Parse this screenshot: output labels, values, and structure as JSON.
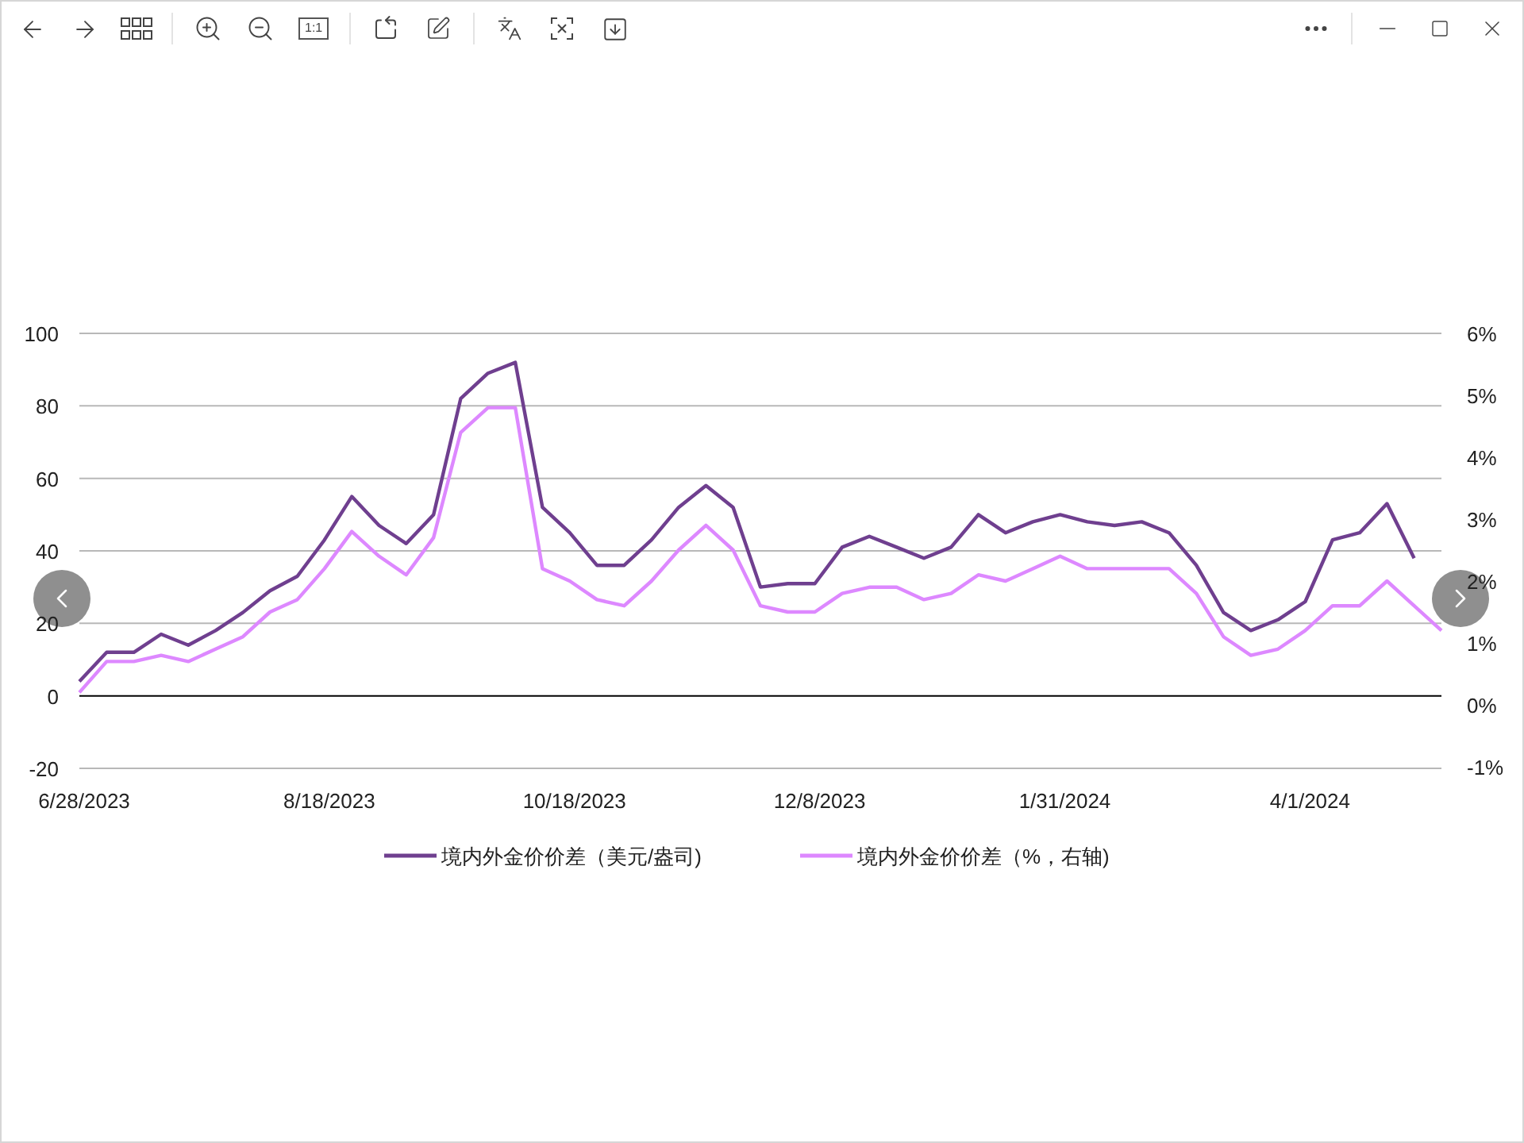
{
  "toolbar": {
    "actual_size_label": "1:1"
  },
  "chart": {
    "chart_data": {
      "type": "line",
      "grid": true,
      "legend": "bottom",
      "y2lim": [
        -1,
        6
      ],
      "y2ticks": [
        {
          "value": 6,
          "label": "6%"
        },
        {
          "value": 5,
          "label": "5%"
        },
        {
          "value": 4,
          "label": "4%"
        },
        {
          "value": 3,
          "label": "3%"
        },
        {
          "value": 2,
          "label": "2%"
        },
        {
          "value": 1,
          "label": "1%"
        },
        {
          "value": 0,
          "label": "0%"
        },
        {
          "value": -1,
          "label": "-1%"
        }
      ],
      "categories": [
        "6/28/2023",
        null,
        null,
        null,
        null,
        null,
        null,
        null,
        null,
        "8/18/2023",
        null,
        null,
        null,
        null,
        null,
        null,
        null,
        null,
        "10/18/2023",
        null,
        null,
        null,
        null,
        null,
        null,
        null,
        null,
        "12/8/2023",
        null,
        null,
        null,
        null,
        null,
        null,
        null,
        null,
        "1/31/2024",
        null,
        null,
        null,
        null,
        null,
        null,
        null,
        null,
        "4/1/2024",
        null,
        null,
        null,
        null,
        null
      ],
      "ylim": [
        -20,
        100
      ],
      "yticks": [
        {
          "value": 100,
          "label": "100"
        },
        {
          "value": 80,
          "label": "80"
        },
        {
          "value": 60,
          "label": "60"
        },
        {
          "value": 40,
          "label": "40"
        },
        {
          "value": 20,
          "label": "20"
        },
        {
          "value": 0,
          "label": "0"
        },
        {
          "value": -20,
          "label": "-20"
        }
      ],
      "series": [
        {
          "name": "境内外金价价差（美元/盎司)",
          "color": "#6f3f8f",
          "values": [
            4,
            12,
            12,
            17,
            14,
            18,
            23,
            29,
            33,
            43,
            55,
            47,
            42,
            50,
            82,
            89,
            92,
            52,
            45,
            36,
            36,
            43,
            52,
            58,
            52,
            30,
            31,
            31,
            41,
            44,
            41,
            38,
            41,
            50,
            45,
            48,
            50,
            48,
            47,
            48,
            45,
            36,
            23,
            18,
            21,
            26,
            43,
            45,
            53,
            38,
            null
          ]
        },
        {
          "name": "境内外金价价差（%，右轴)",
          "color": "#dd88ff",
          "axis": "y2",
          "values": [
            0.2,
            0.7,
            0.7,
            0.8,
            0.7,
            0.9,
            1.1,
            1.5,
            1.7,
            2.2,
            2.8,
            2.4,
            2.1,
            2.7,
            4.4,
            4.8,
            4.8,
            2.2,
            2.0,
            1.7,
            1.6,
            2.0,
            2.5,
            2.9,
            2.5,
            1.6,
            1.5,
            1.5,
            1.8,
            1.9,
            1.9,
            1.7,
            1.8,
            2.1,
            2.0,
            2.2,
            2.4,
            2.2,
            2.2,
            2.2,
            2.2,
            1.8,
            1.1,
            0.8,
            0.9,
            1.2,
            1.6,
            1.6,
            2.0,
            1.6,
            1.2
          ]
        }
      ]
    }
  }
}
